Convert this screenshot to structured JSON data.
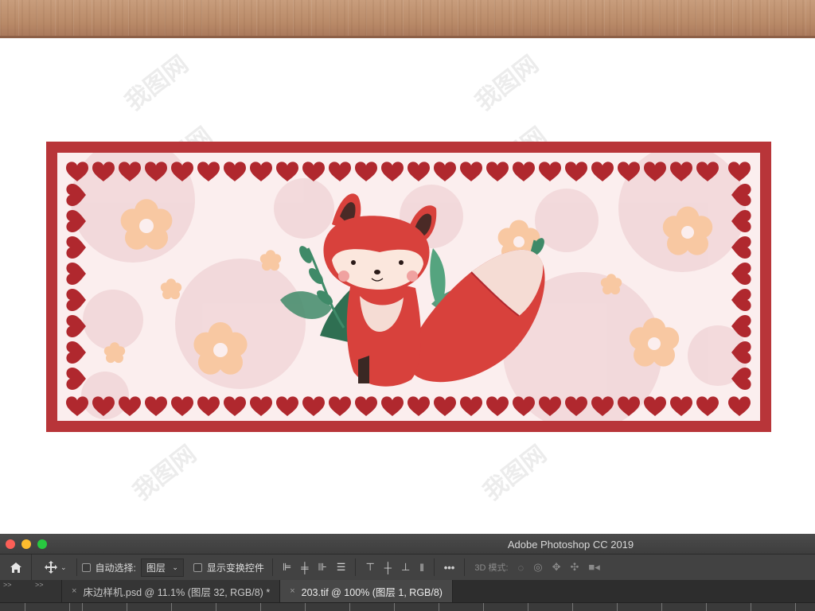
{
  "window": {
    "app_title": "Adobe Photoshop CC 2019"
  },
  "watermark": {
    "text": "我图网"
  },
  "options_bar": {
    "auto_select_label": "自动选择:",
    "layer_select_value": "图层",
    "show_transform_label": "显示变换控件",
    "mode_3d_label": "3D 模式:"
  },
  "tabs": [
    {
      "label": "床边样机.psd @ 11.1% (图层 32, RGB/8) *",
      "close": "×",
      "active": false
    },
    {
      "label": "203.tif @ 100% (图层 1, RGB/8)",
      "close": "×",
      "active": true
    }
  ],
  "panel_collapse": [
    ">>",
    ">>"
  ],
  "colors": {
    "banner_red": "#b83539",
    "banner_bg": "#fbeeee",
    "circle_pink": "#f1d6d8",
    "flower_peach": "#f8c8a2",
    "heart_red": "#b0282e",
    "fox_red": "#d8413c",
    "leaf_green": "#3f8a68"
  },
  "icons": [
    "home-icon",
    "move-tool-icon",
    "align-icons",
    "distribute-icons",
    "more-icon",
    "3d-orbit-icon",
    "3d-roll-icon",
    "3d-pan-icon",
    "3d-slide-icon",
    "3d-scale-icon"
  ]
}
